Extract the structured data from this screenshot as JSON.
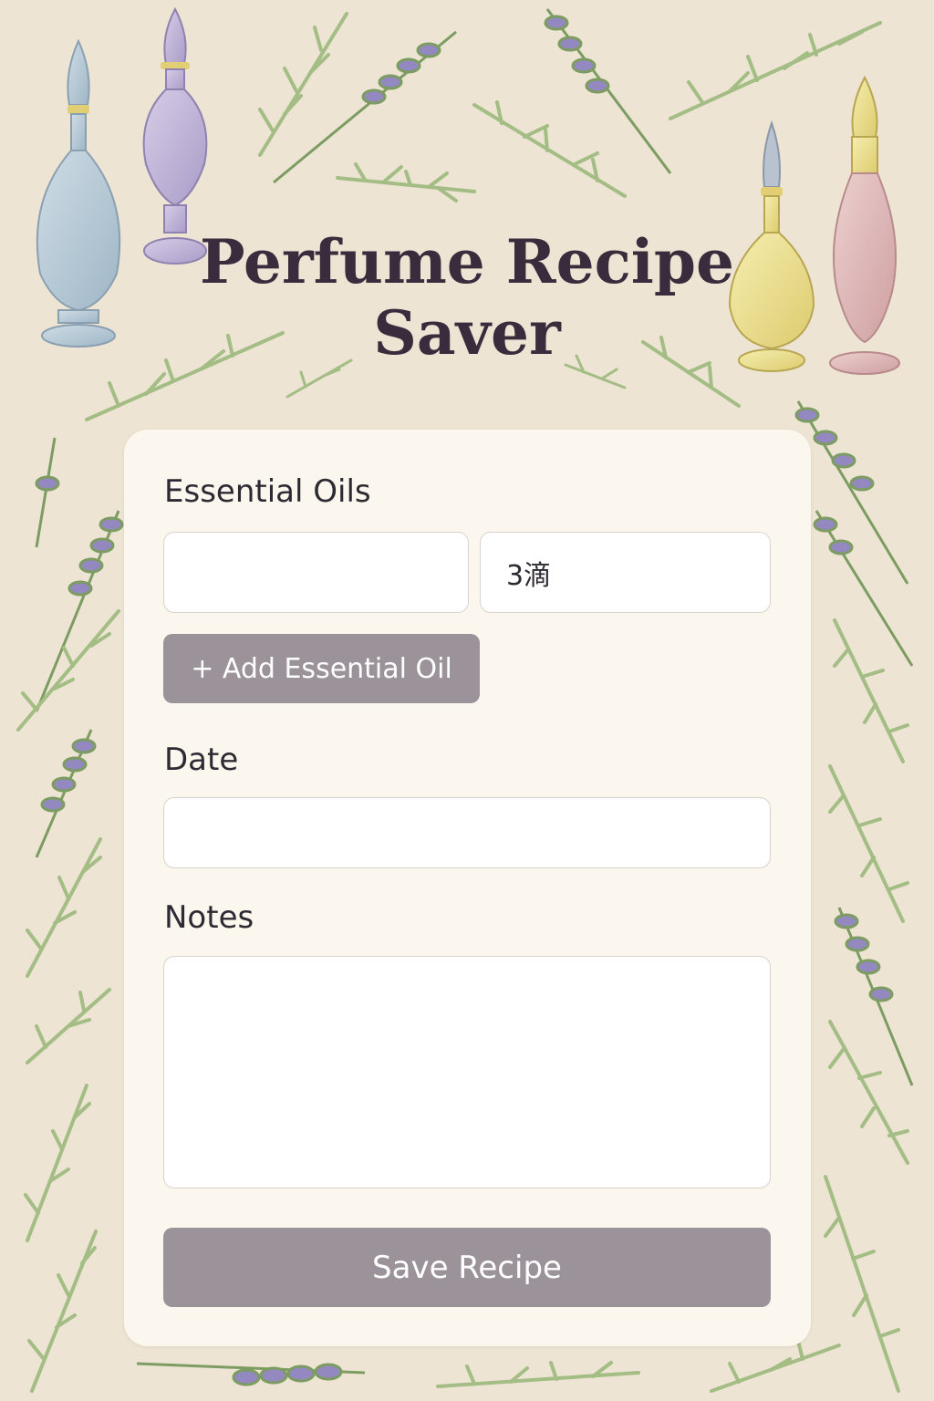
{
  "app": {
    "title": "Perfume Recipe Saver"
  },
  "form": {
    "essential_oils_label": "Essential Oils",
    "oil_name_value": "",
    "oil_amount_value": "3滴",
    "add_oil_button": "+ Add Essential Oil",
    "date_label": "Date",
    "date_value": "",
    "notes_label": "Notes",
    "notes_value": "",
    "save_button": "Save Recipe"
  },
  "colors": {
    "background": "#ede4d3",
    "card": "#fbf7ee",
    "title_text": "#3a2c3c",
    "button": "#9b929a",
    "lavender": "#8e83b8",
    "leaf": "#a9bf8a"
  },
  "decorations": {
    "icons": [
      "perfume-bottle-icon",
      "lavender-sprig-icon",
      "rosemary-sprig-icon"
    ]
  }
}
